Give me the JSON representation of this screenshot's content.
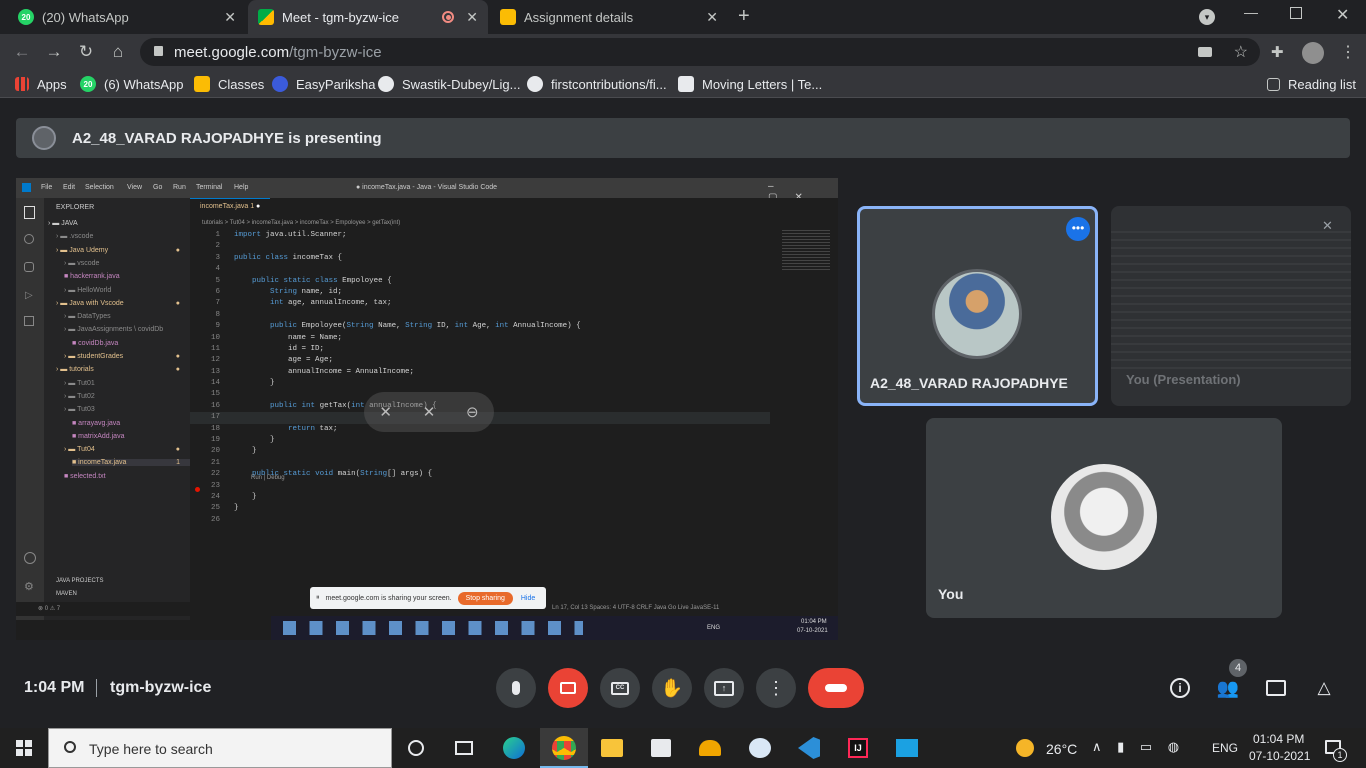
{
  "browser": {
    "tabs": [
      {
        "label": "(20) WhatsApp",
        "favicon_text": "20"
      },
      {
        "label": "Meet - tgm-byzw-ice"
      },
      {
        "label": "Assignment details"
      }
    ],
    "url_domain": "meet.google.com",
    "url_path": "/tgm-byzw-ice"
  },
  "bookmarks": {
    "items": [
      {
        "label": "Apps"
      },
      {
        "label": "(6) WhatsApp",
        "favicon_text": "20"
      },
      {
        "label": "Classes"
      },
      {
        "label": "EasyPariksha"
      },
      {
        "label": "Swastik-Dubey/Lig..."
      },
      {
        "label": "firstcontributions/fi..."
      },
      {
        "label": "Moving Letters | Te..."
      }
    ],
    "reading_list": "Reading list"
  },
  "meet": {
    "presenting_banner": "A2_48_VARAD RAJOPADHYE is presenting",
    "time": "1:04 PM",
    "meeting_code": "tgm-byzw-ice",
    "participant_count": "4",
    "tiles": {
      "presenter_name": "A2_48_VARAD RAJOPADHYE",
      "presentation_label": "You (Presentation)",
      "self_label": "You"
    }
  },
  "vscode": {
    "menu": [
      "File",
      "Edit",
      "Selection",
      "View",
      "Go",
      "Run",
      "Terminal",
      "Help"
    ],
    "title": "● incomeTax.java - Java - Visual Studio Code",
    "explorer_header": "EXPLORER",
    "tree": [
      {
        "label": "JAVA",
        "depth": 0
      },
      {
        "label": ".vscode",
        "depth": 1
      },
      {
        "label": "Java Udemy",
        "depth": 1,
        "mod": true
      },
      {
        "label": "vscode",
        "depth": 2
      },
      {
        "label": "hackerrank.java",
        "depth": 2
      },
      {
        "label": "HelloWorld",
        "depth": 2
      },
      {
        "label": "Java with Vscode",
        "depth": 1,
        "mod": true
      },
      {
        "label": "DataTypes",
        "depth": 2
      },
      {
        "label": "JavaAssignments \\ covidDb",
        "depth": 2
      },
      {
        "label": "covidDb.java",
        "depth": 3
      },
      {
        "label": "studentGrades",
        "depth": 2,
        "mod": true
      },
      {
        "label": "tutorials",
        "depth": 1,
        "mod": true
      },
      {
        "label": "Tut01",
        "depth": 2
      },
      {
        "label": "Tut02",
        "depth": 2
      },
      {
        "label": "Tut03",
        "depth": 2
      },
      {
        "label": "arrayavg.java",
        "depth": 3
      },
      {
        "label": "matrixAdd.java",
        "depth": 3
      },
      {
        "label": "Tut04",
        "depth": 2,
        "mod": true
      },
      {
        "label": "incomeTax.java",
        "depth": 3,
        "badge": "1"
      },
      {
        "label": "selected.txt",
        "depth": 2
      }
    ],
    "bottom_sections": [
      "JAVA PROJECTS",
      "MAVEN"
    ],
    "editor_tab": "incomeTax.java 1",
    "breadcrumb": "tutorials > Tut04 > incomeTax.java > incomeTax > Empoloyee > getTax(int)",
    "code_lines": [
      "import java.util.Scanner;",
      "",
      "public class incomeTax {",
      "",
      "    public static class Empoloyee {",
      "        String name, id;",
      "        int age, annualIncome, tax;",
      "",
      "        public Empoloyee(String Name, String ID, int Age, int AnnualIncome) {",
      "            name = Name;",
      "            id = ID;",
      "            age = Age;",
      "            annualIncome = AnnualIncome;",
      "        }",
      "",
      "        public int getTax(int annualIncome) {",
      "            ",
      "            return tax;",
      "        }",
      "    }",
      "",
      "    public static void main(String[] args) {",
      "",
      "    }",
      "}",
      ""
    ],
    "codelens": "Run | Debug",
    "status": "Ln 17, Col 13   Spaces: 4   UTF-8   CRLF   Java   Go Live   JavaSE-11",
    "status_left": "⊗ 0 ⚠ 7",
    "share_notice": "meet.google.com is sharing your screen.",
    "stop_sharing": "Stop sharing",
    "hide": "Hide",
    "inner_clock_time": "01:04 PM",
    "inner_clock_date": "07-10-2021",
    "inner_lang": "ENG"
  },
  "taskbar": {
    "search_placeholder": "Type here to search",
    "weather": "26°C",
    "lang": "ENG",
    "time": "01:04 PM",
    "date": "07-10-2021",
    "notification_count": "1"
  },
  "colors": {
    "meet_red": "#ea4335",
    "accent_blue": "#8ab4f8",
    "tile_bg": "#3c4043",
    "vscode_blue": "#007acc"
  }
}
